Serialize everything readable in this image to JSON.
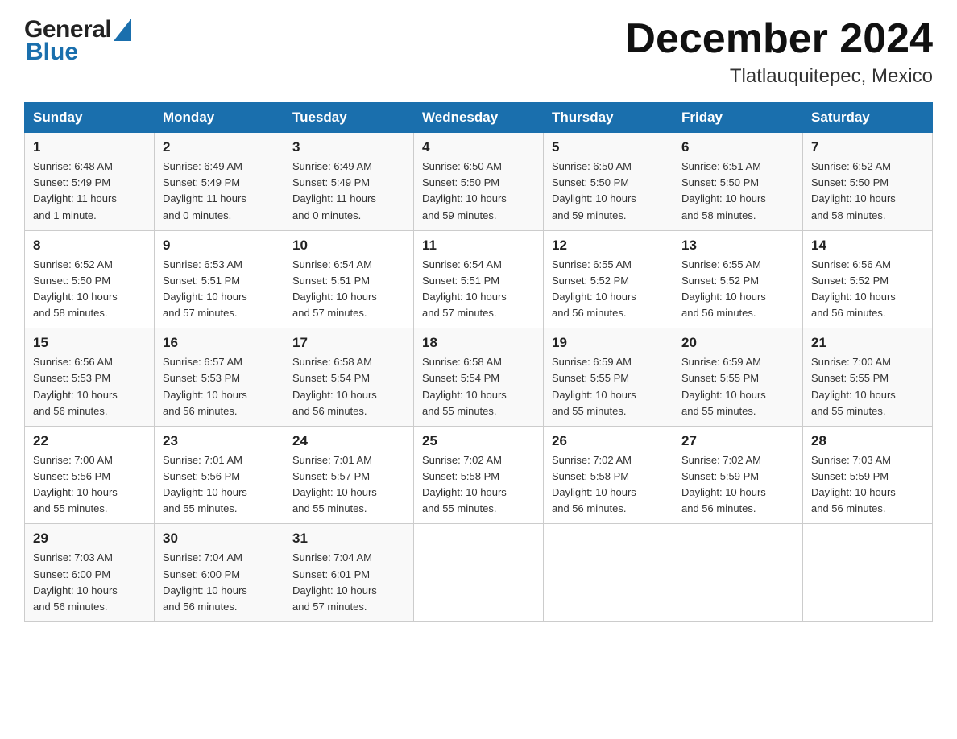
{
  "header": {
    "month_title": "December 2024",
    "location": "Tlatlauquitepec, Mexico"
  },
  "days_of_week": [
    "Sunday",
    "Monday",
    "Tuesday",
    "Wednesday",
    "Thursday",
    "Friday",
    "Saturday"
  ],
  "weeks": [
    [
      {
        "day": "1",
        "sunrise": "6:48 AM",
        "sunset": "5:49 PM",
        "daylight": "11 hours and 1 minute."
      },
      {
        "day": "2",
        "sunrise": "6:49 AM",
        "sunset": "5:49 PM",
        "daylight": "11 hours and 0 minutes."
      },
      {
        "day": "3",
        "sunrise": "6:49 AM",
        "sunset": "5:49 PM",
        "daylight": "11 hours and 0 minutes."
      },
      {
        "day": "4",
        "sunrise": "6:50 AM",
        "sunset": "5:50 PM",
        "daylight": "10 hours and 59 minutes."
      },
      {
        "day": "5",
        "sunrise": "6:50 AM",
        "sunset": "5:50 PM",
        "daylight": "10 hours and 59 minutes."
      },
      {
        "day": "6",
        "sunrise": "6:51 AM",
        "sunset": "5:50 PM",
        "daylight": "10 hours and 58 minutes."
      },
      {
        "day": "7",
        "sunrise": "6:52 AM",
        "sunset": "5:50 PM",
        "daylight": "10 hours and 58 minutes."
      }
    ],
    [
      {
        "day": "8",
        "sunrise": "6:52 AM",
        "sunset": "5:50 PM",
        "daylight": "10 hours and 58 minutes."
      },
      {
        "day": "9",
        "sunrise": "6:53 AM",
        "sunset": "5:51 PM",
        "daylight": "10 hours and 57 minutes."
      },
      {
        "day": "10",
        "sunrise": "6:54 AM",
        "sunset": "5:51 PM",
        "daylight": "10 hours and 57 minutes."
      },
      {
        "day": "11",
        "sunrise": "6:54 AM",
        "sunset": "5:51 PM",
        "daylight": "10 hours and 57 minutes."
      },
      {
        "day": "12",
        "sunrise": "6:55 AM",
        "sunset": "5:52 PM",
        "daylight": "10 hours and 56 minutes."
      },
      {
        "day": "13",
        "sunrise": "6:55 AM",
        "sunset": "5:52 PM",
        "daylight": "10 hours and 56 minutes."
      },
      {
        "day": "14",
        "sunrise": "6:56 AM",
        "sunset": "5:52 PM",
        "daylight": "10 hours and 56 minutes."
      }
    ],
    [
      {
        "day": "15",
        "sunrise": "6:56 AM",
        "sunset": "5:53 PM",
        "daylight": "10 hours and 56 minutes."
      },
      {
        "day": "16",
        "sunrise": "6:57 AM",
        "sunset": "5:53 PM",
        "daylight": "10 hours and 56 minutes."
      },
      {
        "day": "17",
        "sunrise": "6:58 AM",
        "sunset": "5:54 PM",
        "daylight": "10 hours and 56 minutes."
      },
      {
        "day": "18",
        "sunrise": "6:58 AM",
        "sunset": "5:54 PM",
        "daylight": "10 hours and 55 minutes."
      },
      {
        "day": "19",
        "sunrise": "6:59 AM",
        "sunset": "5:55 PM",
        "daylight": "10 hours and 55 minutes."
      },
      {
        "day": "20",
        "sunrise": "6:59 AM",
        "sunset": "5:55 PM",
        "daylight": "10 hours and 55 minutes."
      },
      {
        "day": "21",
        "sunrise": "7:00 AM",
        "sunset": "5:55 PM",
        "daylight": "10 hours and 55 minutes."
      }
    ],
    [
      {
        "day": "22",
        "sunrise": "7:00 AM",
        "sunset": "5:56 PM",
        "daylight": "10 hours and 55 minutes."
      },
      {
        "day": "23",
        "sunrise": "7:01 AM",
        "sunset": "5:56 PM",
        "daylight": "10 hours and 55 minutes."
      },
      {
        "day": "24",
        "sunrise": "7:01 AM",
        "sunset": "5:57 PM",
        "daylight": "10 hours and 55 minutes."
      },
      {
        "day": "25",
        "sunrise": "7:02 AM",
        "sunset": "5:58 PM",
        "daylight": "10 hours and 55 minutes."
      },
      {
        "day": "26",
        "sunrise": "7:02 AM",
        "sunset": "5:58 PM",
        "daylight": "10 hours and 56 minutes."
      },
      {
        "day": "27",
        "sunrise": "7:02 AM",
        "sunset": "5:59 PM",
        "daylight": "10 hours and 56 minutes."
      },
      {
        "day": "28",
        "sunrise": "7:03 AM",
        "sunset": "5:59 PM",
        "daylight": "10 hours and 56 minutes."
      }
    ],
    [
      {
        "day": "29",
        "sunrise": "7:03 AM",
        "sunset": "6:00 PM",
        "daylight": "10 hours and 56 minutes."
      },
      {
        "day": "30",
        "sunrise": "7:04 AM",
        "sunset": "6:00 PM",
        "daylight": "10 hours and 56 minutes."
      },
      {
        "day": "31",
        "sunrise": "7:04 AM",
        "sunset": "6:01 PM",
        "daylight": "10 hours and 57 minutes."
      },
      null,
      null,
      null,
      null
    ]
  ],
  "logo": {
    "general": "General",
    "blue": "Blue"
  }
}
